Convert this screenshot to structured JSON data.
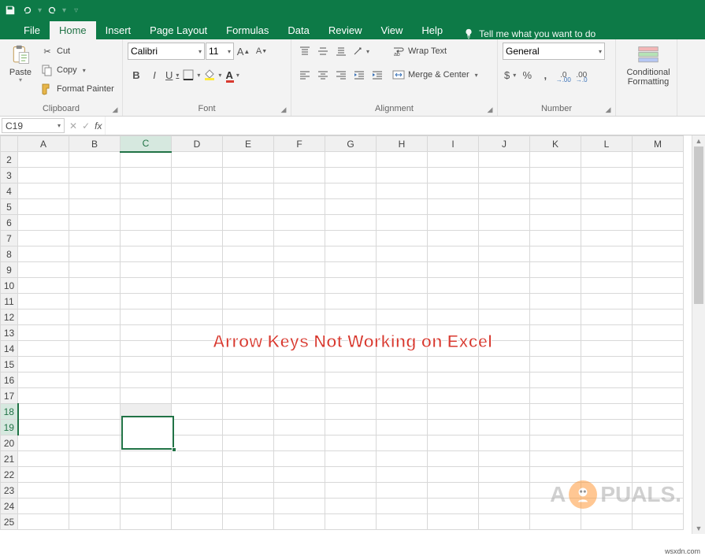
{
  "tabs": [
    "File",
    "Home",
    "Insert",
    "Page Layout",
    "Formulas",
    "Data",
    "Review",
    "View",
    "Help"
  ],
  "active_tab": "Home",
  "tellme": "Tell me what you want to do",
  "clipboard": {
    "paste": "Paste",
    "cut": "Cut",
    "copy": "Copy",
    "format_painter": "Format Painter",
    "label": "Clipboard"
  },
  "font": {
    "name": "Calibri",
    "size": "11",
    "label": "Font"
  },
  "alignment": {
    "wrap": "Wrap Text",
    "merge": "Merge & Center",
    "label": "Alignment"
  },
  "number": {
    "format": "General",
    "label": "Number"
  },
  "cond_format": "Conditional Formatting",
  "namebox": "C19",
  "columns": [
    "A",
    "B",
    "C",
    "D",
    "E",
    "F",
    "G",
    "H",
    "I",
    "J",
    "K",
    "L",
    "M"
  ],
  "rows_start": 2,
  "rows_end": 25,
  "selected_col": "C",
  "selected_rows": [
    18,
    19
  ],
  "active_row": 19,
  "overlay_text": "Arrow Keys Not Working on Excel",
  "watermark_text": "A  PUALS",
  "source_text": "wsxdn.com"
}
